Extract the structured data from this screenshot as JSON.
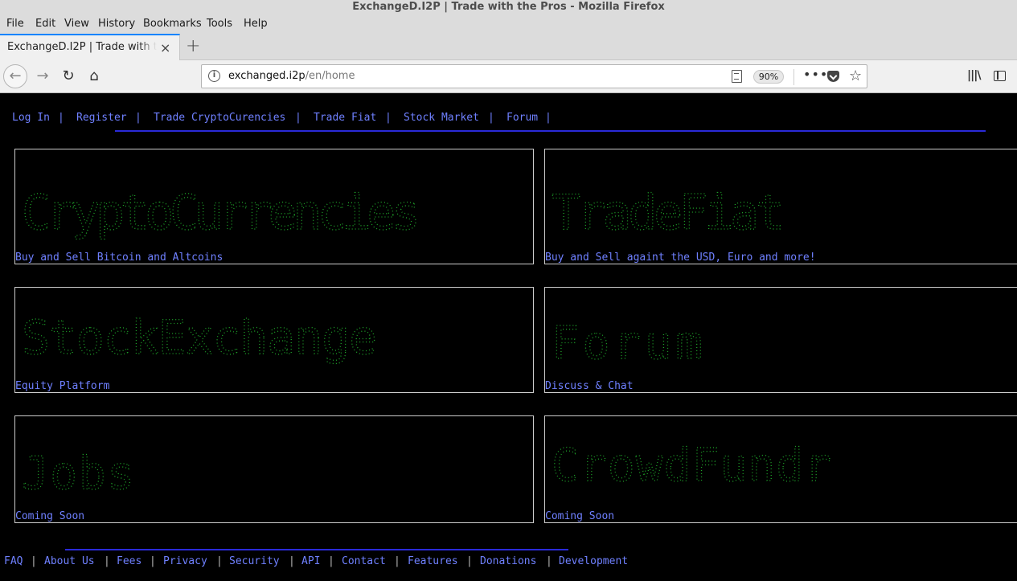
{
  "window": {
    "title": "ExchangeD.I2P | Trade with the Pros - Mozilla Firefox"
  },
  "menu": [
    "File",
    "Edit",
    "View",
    "History",
    "Bookmarks",
    "Tools",
    "Help"
  ],
  "tab": {
    "title": "ExchangeD.I2P | Trade with the Pros",
    "close": "×",
    "new": "+"
  },
  "toolbar": {
    "url_host": "exchanged.i2p",
    "url_path": "/en/home",
    "zoom": "90%",
    "more": "•••",
    "star": "☆",
    "library": "|||\\",
    "back": "←",
    "forward": "→",
    "reload": "↻",
    "home": "⌂",
    "info": "i"
  },
  "nav": {
    "items": [
      "Log In",
      "Register",
      "Trade CryptoCurencies",
      "Trade Fiat",
      "Stock Market",
      "Forum"
    ],
    "separator": "|"
  },
  "cards": [
    {
      "id": "crypto",
      "caption": "Buy and Sell Bitcoin and Altcoins",
      "art_text": "CryptoCurrencies"
    },
    {
      "id": "fiat",
      "caption": "Buy and Sell againt the USD, Euro and more!",
      "art_text": "TradeFiat"
    },
    {
      "id": "stock",
      "caption": "Equity Platform",
      "art_text": "StockExchange"
    },
    {
      "id": "forum",
      "caption": "Discuss & Chat",
      "art_text": "Forum"
    },
    {
      "id": "jobs",
      "caption": "Coming Soon",
      "art_text": "Jobs"
    },
    {
      "id": "crowd",
      "caption": "Coming Soon",
      "art_text": "CrowdFundr"
    }
  ],
  "footer": {
    "items": [
      "FAQ",
      "About Us",
      "Fees",
      "Privacy",
      "Security",
      "API",
      "Contact",
      "Features",
      "Donations",
      "Development"
    ],
    "separator": "|"
  },
  "colors": {
    "link": "#6f80ff",
    "art": "#1fa32a",
    "rule": "#2a2ad8",
    "background": "#000000"
  }
}
